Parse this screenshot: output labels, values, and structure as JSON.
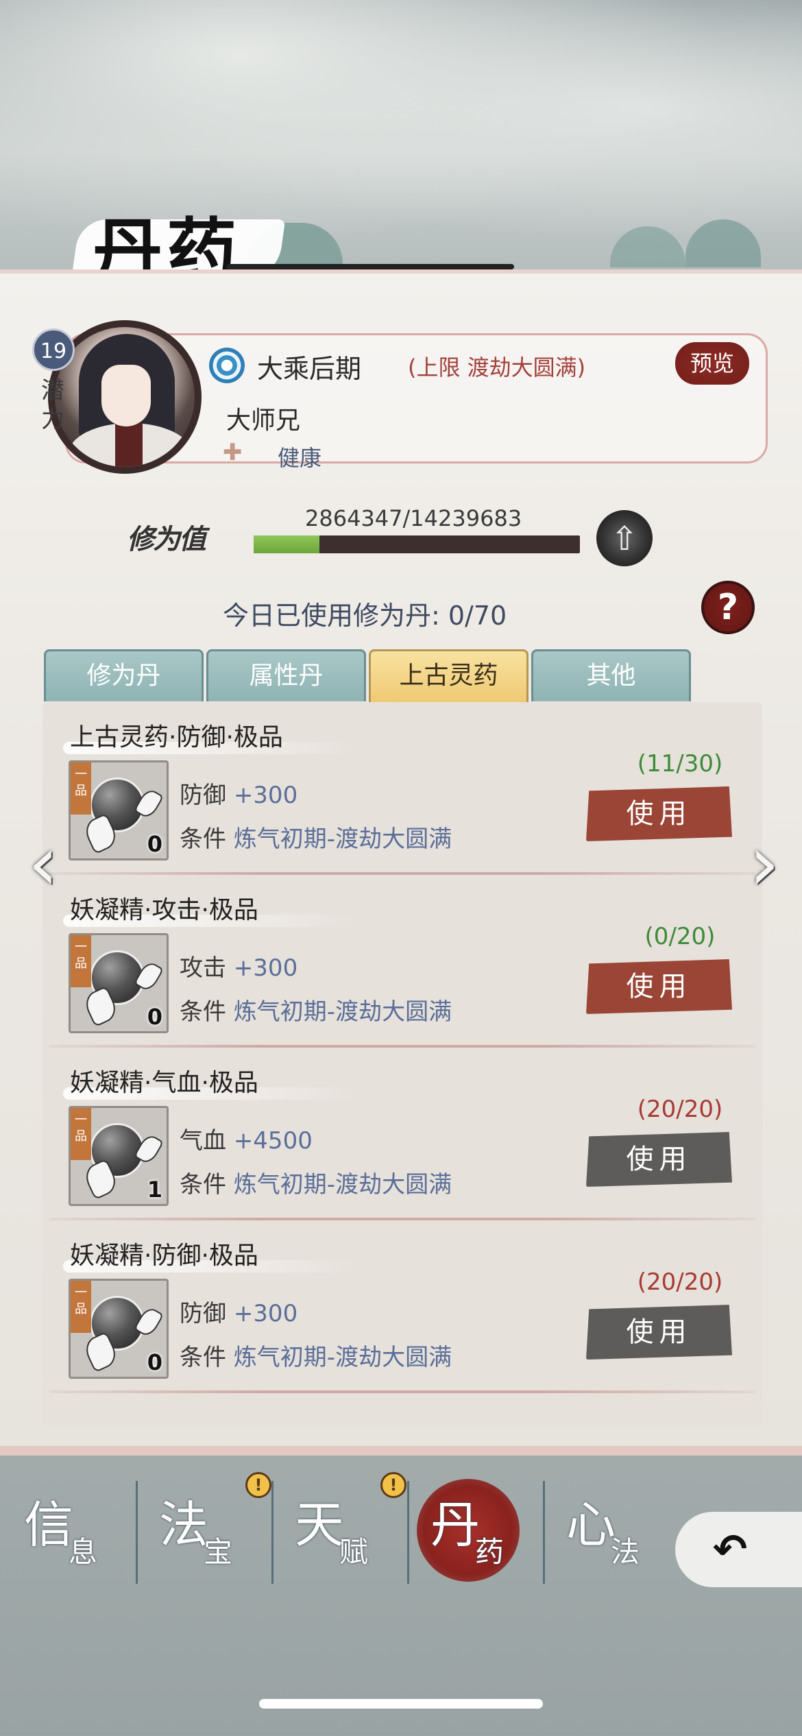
{
  "page": {
    "title": "丹药"
  },
  "character": {
    "level": "19",
    "potential_label": "潜力",
    "realm": "大乘后期",
    "realm_cap": "(上限 渡劫大圆满)",
    "preview_label": "预览",
    "name": "大师兄",
    "status": "健康"
  },
  "cultivation": {
    "label": "修为值",
    "value_text": "2864347/14239683",
    "current": 2864347,
    "max": 14239683,
    "progress": 0.2012
  },
  "daily": {
    "text": "今日已使用修为丹: 0/70"
  },
  "tabs": [
    {
      "label": "修为丹",
      "active": false
    },
    {
      "label": "属性丹",
      "active": false
    },
    {
      "label": "上古灵药",
      "active": true
    },
    {
      "label": "其他",
      "active": false
    }
  ],
  "items": [
    {
      "name": "上古灵药·防御·极品",
      "grade": "一品",
      "count": "0",
      "effect_label": "防御",
      "effect_value": "+300",
      "cond_label": "条件",
      "cond_value": "炼气初期-渡劫大圆满",
      "progress": "(11/30)",
      "progress_color": "#3f8a3a",
      "use_label": "使用",
      "enabled": true
    },
    {
      "name": "妖凝精·攻击·极品",
      "grade": "一品",
      "count": "0",
      "effect_label": "攻击",
      "effect_value": "+300",
      "cond_label": "条件",
      "cond_value": "炼气初期-渡劫大圆满",
      "progress": "(0/20)",
      "progress_color": "#3f8a3a",
      "use_label": "使用",
      "enabled": true
    },
    {
      "name": "妖凝精·气血·极品",
      "grade": "一品",
      "count": "1",
      "effect_label": "气血",
      "effect_value": "+4500",
      "cond_label": "条件",
      "cond_value": "炼气初期-渡劫大圆满",
      "progress": "(20/20)",
      "progress_color": "#a83a32",
      "use_label": "使用",
      "enabled": false
    },
    {
      "name": "妖凝精·防御·极品",
      "grade": "一品",
      "count": "0",
      "effect_label": "防御",
      "effect_value": "+300",
      "cond_label": "条件",
      "cond_value": "炼气初期-渡劫大圆满",
      "progress": "(20/20)",
      "progress_color": "#a83a32",
      "use_label": "使用",
      "enabled": false
    }
  ],
  "nav": [
    {
      "big": "信",
      "small": "息",
      "alert": false,
      "active": false
    },
    {
      "big": "法",
      "small": "宝",
      "alert": true,
      "active": false
    },
    {
      "big": "天",
      "small": "赋",
      "alert": true,
      "active": false
    },
    {
      "big": "丹",
      "small": "药",
      "alert": false,
      "active": true
    },
    {
      "big": "心",
      "small": "法",
      "alert": false,
      "active": false
    }
  ],
  "alert_symbol": "!",
  "icons": {
    "realm": "swirl-orb-icon",
    "status": "heart-plus-icon",
    "upgrade": "up-arrow-icon",
    "help": "question-icon",
    "prev": "chevron-left-icon",
    "next": "chevron-right-icon",
    "back": "back-arrow-icon"
  },
  "colors": {
    "accent_red": "#9a4535",
    "disabled_gray": "#5e5c5a",
    "tab_active": "#efc872",
    "tab_inactive": "#8fb3b3"
  }
}
